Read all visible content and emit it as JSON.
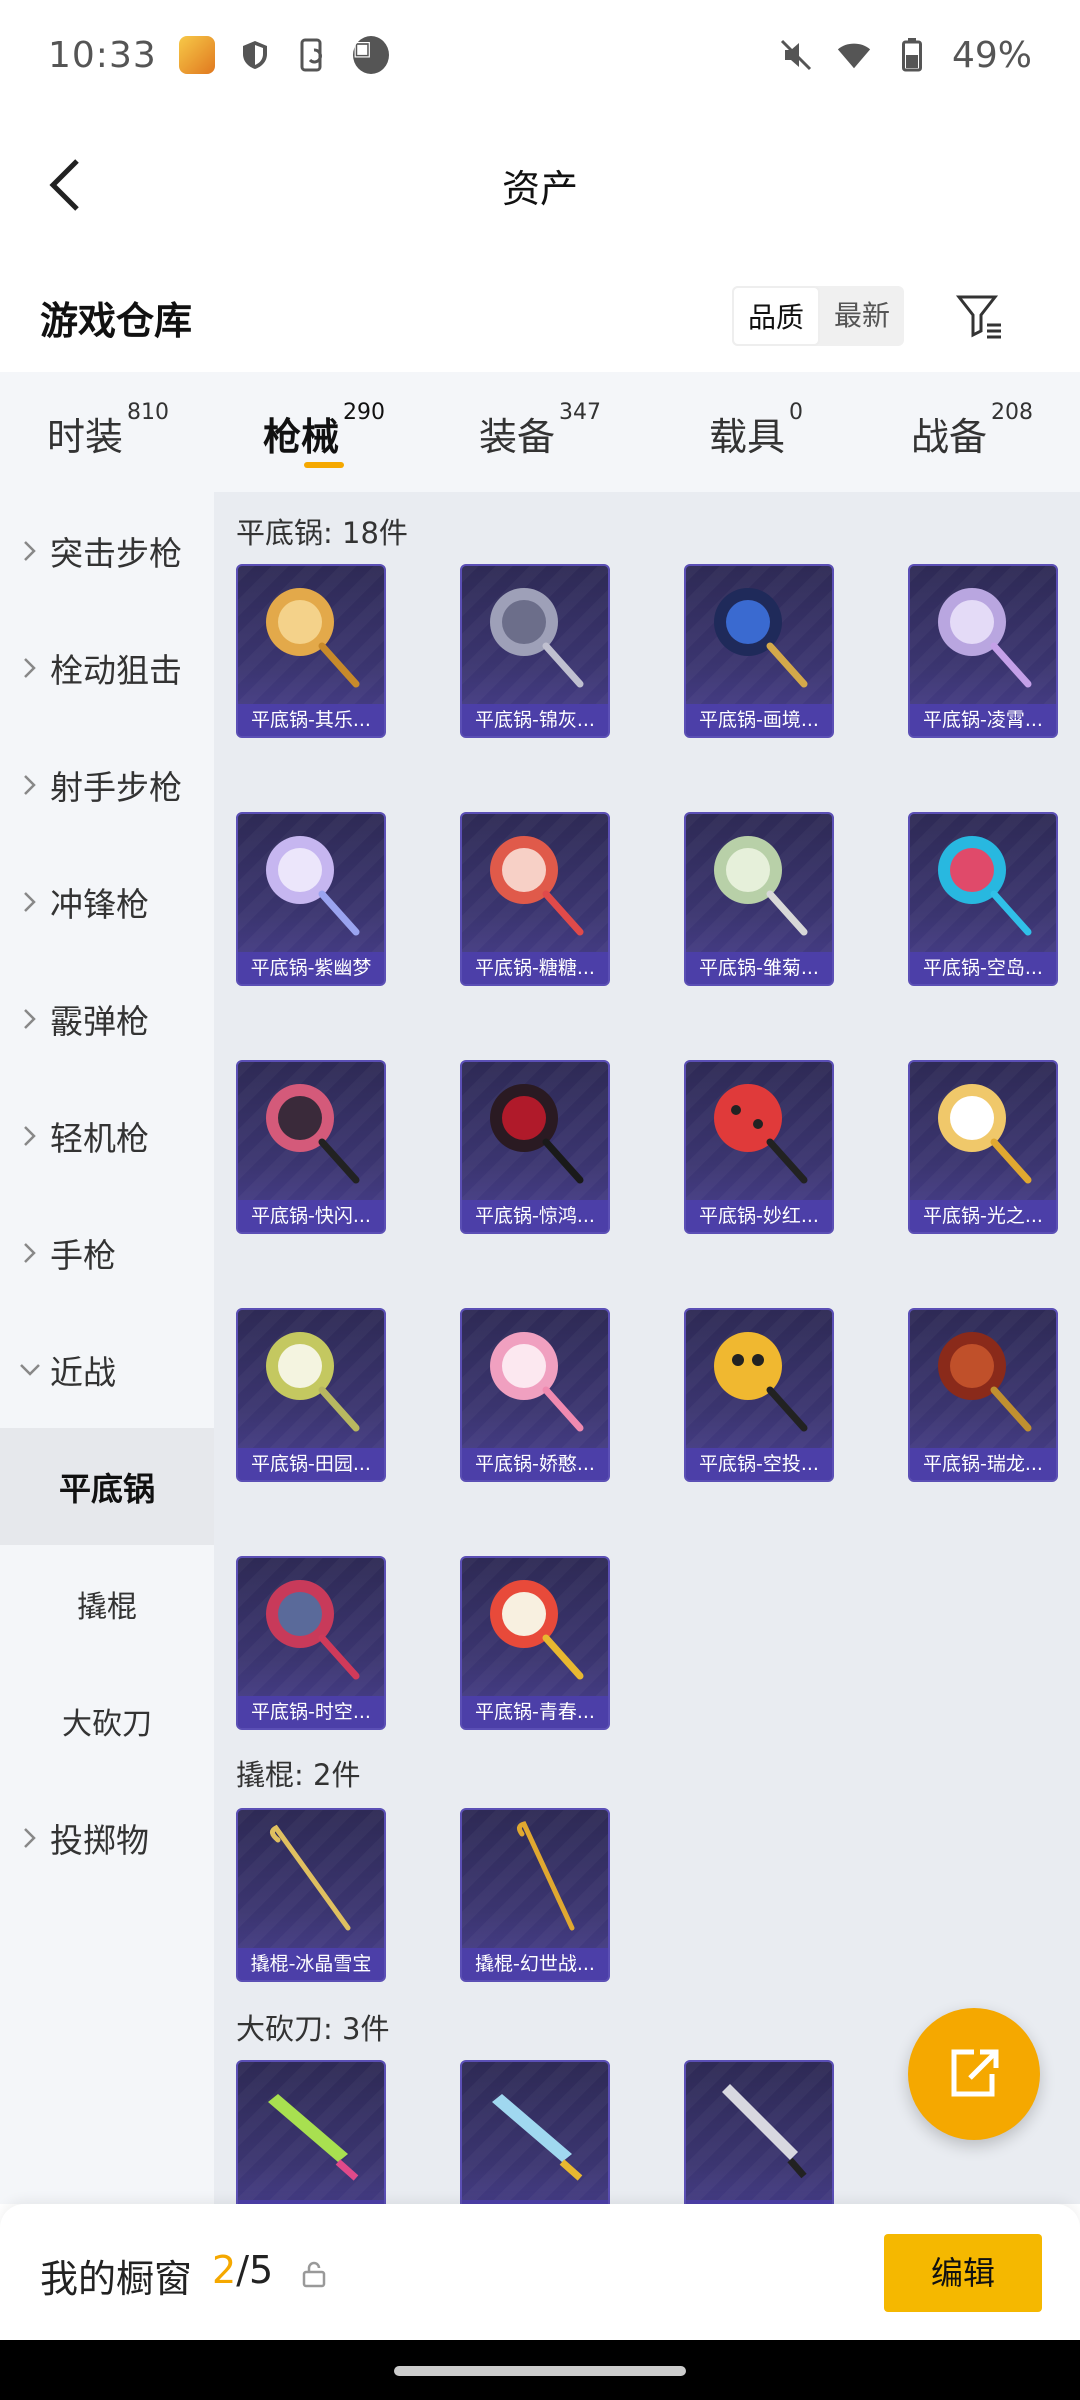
{
  "status_bar": {
    "time": "10:33",
    "battery": "49%"
  },
  "header": {
    "title": "资产"
  },
  "warehouse": {
    "title": "游戏仓库",
    "sort_options": [
      "品质",
      "最新"
    ],
    "active_sort": 0
  },
  "tabs": [
    {
      "label": "时装",
      "count": "810"
    },
    {
      "label": "枪械",
      "count": "290"
    },
    {
      "label": "装备",
      "count": "347"
    },
    {
      "label": "载具",
      "count": "0"
    },
    {
      "label": "战备",
      "count": "208"
    }
  ],
  "sidebar": {
    "categories": [
      "突击步枪",
      "栓动狙击",
      "射手步枪",
      "冲锋枪",
      "霰弹枪",
      "轻机枪",
      "手枪",
      "近战"
    ],
    "sub_items": [
      "平底锅",
      "撬棍",
      "大砍刀"
    ],
    "after": "投掷物"
  },
  "sections": [
    {
      "title": "平底锅: 18件",
      "items": [
        "平底锅-其乐...",
        "平底锅-锦灰...",
        "平底锅-画境...",
        "平底锅-凌霄...",
        "平底锅-紫幽梦",
        "平底锅-糖糖...",
        "平底锅-雏菊...",
        "平底锅-空岛...",
        "平底锅-快闪...",
        "平底锅-惊鸿...",
        "平底锅-妙红...",
        "平底锅-光之...",
        "平底锅-田园...",
        "平底锅-娇憨...",
        "平底锅-空投...",
        "平底锅-瑞龙...",
        "平底锅-时空...",
        "平底锅-青春..."
      ]
    },
    {
      "title": "撬棍: 2件",
      "items": [
        "撬棍-冰晶雪宝",
        "撬棍-幻世战..."
      ]
    },
    {
      "title": "大砍刀: 3件",
      "items": [
        "",
        "",
        ""
      ]
    }
  ],
  "bottom": {
    "label": "我的橱窗",
    "count_current": "2",
    "count_total": "/5",
    "edit_label": "编辑"
  },
  "colors": {
    "accent": "#f5a800",
    "card_bg": "#3b3570",
    "card_label": "#4c3fa8"
  }
}
